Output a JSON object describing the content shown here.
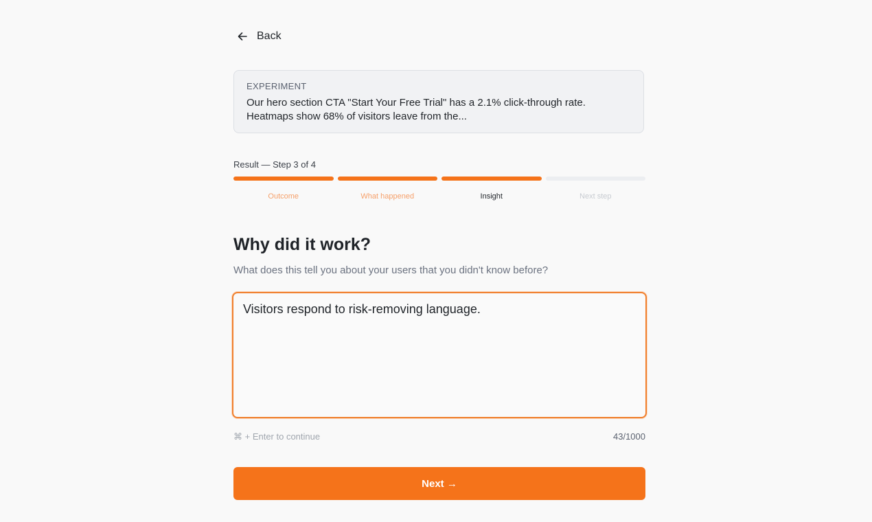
{
  "nav": {
    "back_label": "Back",
    "back_icon": "arrow-left-icon"
  },
  "experiment": {
    "label": "EXPERIMENT",
    "text": "Our hero section CTA \"Start Your Free Trial\" has a 2.1% click-through rate. Heatmaps show 68% of visitors leave from the..."
  },
  "progress": {
    "label": "Result — Step 3 of 4",
    "current_step": 3,
    "total_steps": 4,
    "steps": [
      {
        "label": "Outcome",
        "state": "done"
      },
      {
        "label": "What happened",
        "state": "done"
      },
      {
        "label": "Insight",
        "state": "current"
      },
      {
        "label": "Next step",
        "state": "future"
      }
    ]
  },
  "question": {
    "title": "Why did it work?",
    "subtitle": "What does this tell you about your users that you didn't know before?"
  },
  "answer": {
    "value": "Visitors respond to risk-removing language."
  },
  "footer": {
    "hint": "⌘ + Enter to continue",
    "counter": "43/1000"
  },
  "next_button": {
    "label": "Next →"
  },
  "colors": {
    "accent": "#f5731a",
    "done_label": "#f6a06a",
    "future_label": "#c7cbd1",
    "track": "#eceef1"
  }
}
